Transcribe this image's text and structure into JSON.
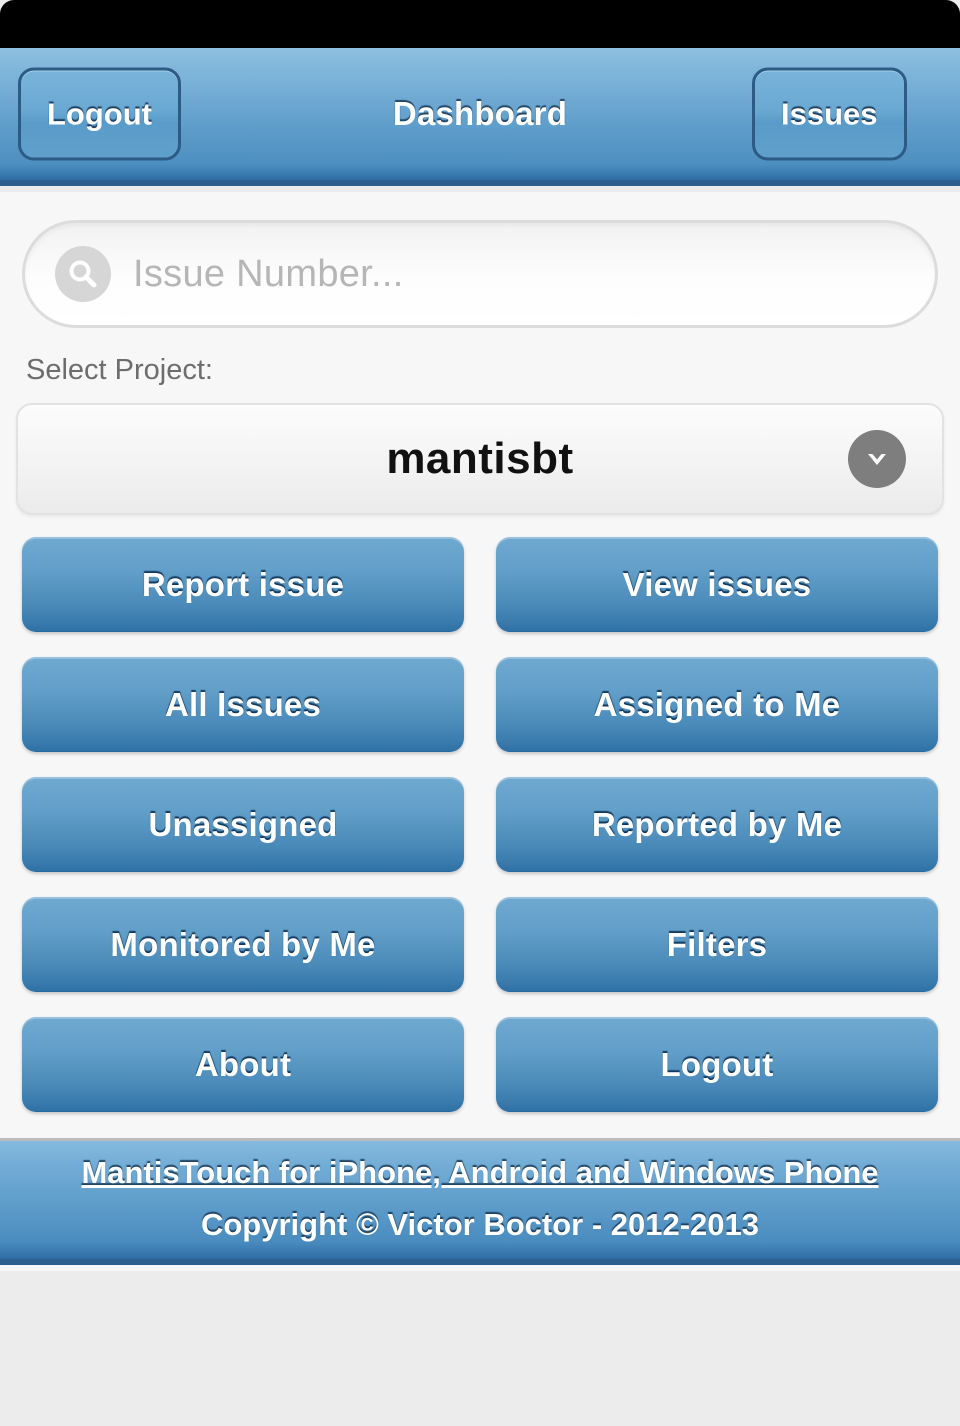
{
  "navbar": {
    "title": "Dashboard",
    "left_button": "Logout",
    "right_button": "Issues"
  },
  "search": {
    "placeholder": "Issue Number...",
    "value": "",
    "icon": "search-icon"
  },
  "project": {
    "label": "Select Project:",
    "selected": "mantisbt",
    "chevron_icon": "chevron-down-icon"
  },
  "actions": [
    {
      "label": "Report issue"
    },
    {
      "label": "View issues"
    },
    {
      "label": "All Issues"
    },
    {
      "label": "Assigned to Me"
    },
    {
      "label": "Unassigned"
    },
    {
      "label": "Reported by Me"
    },
    {
      "label": "Monitored by Me"
    },
    {
      "label": "Filters"
    },
    {
      "label": "About"
    },
    {
      "label": "Logout"
    }
  ],
  "footer": {
    "link": "MantisTouch for iPhone, Android and Windows Phone",
    "copyright": "Copyright © Victor Boctor - 2012-2013"
  },
  "colors": {
    "accent_blue": "#2e6da4",
    "button_top": "#6fa9d0",
    "button_bottom": "#1f5f92",
    "nav_light": "#8fc0e0",
    "page_bg": "#ececec",
    "content_bg": "#f7f7f7"
  }
}
